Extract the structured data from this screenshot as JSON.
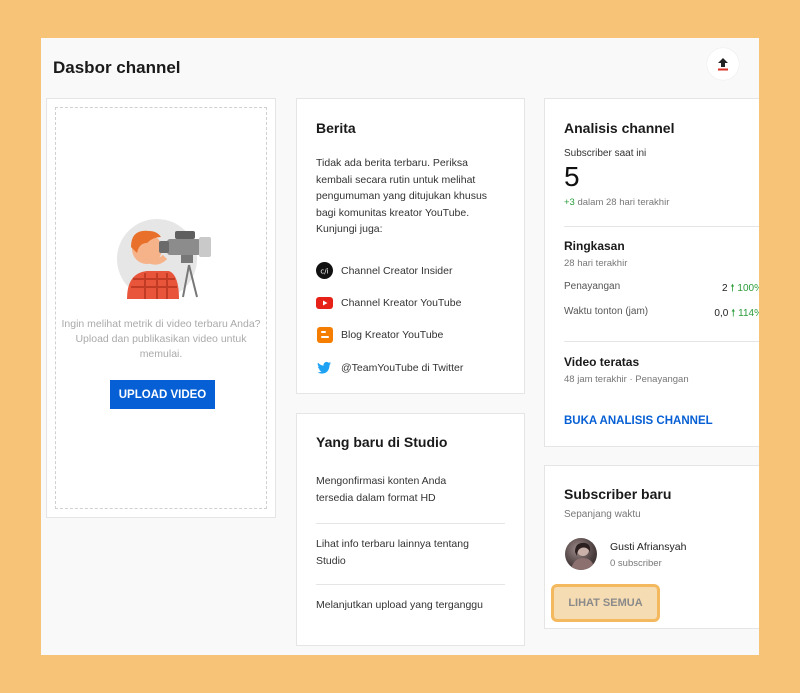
{
  "header": {
    "title": "Dasbor channel"
  },
  "upload_card": {
    "hint": "Ingin melihat metrik di video terbaru Anda? Upload dan publikasikan video untuk memulai.",
    "button": "UPLOAD VIDEO"
  },
  "news": {
    "title": "Berita",
    "body": "Tidak ada berita terbaru. Periksa kembali secara rutin untuk melihat pengumuman yang ditujukan khusus bagi komunitas kreator YouTube. Kunjungi juga:",
    "links": [
      {
        "label": "Channel Creator Insider",
        "icon": "creator-insider-icon"
      },
      {
        "label": "Channel Kreator YouTube",
        "icon": "youtube-icon"
      },
      {
        "label": "Blog Kreator YouTube",
        "icon": "blogger-icon"
      },
      {
        "label": "@TeamYouTube di Twitter",
        "icon": "twitter-icon"
      }
    ]
  },
  "whats_new": {
    "title": "Yang baru di Studio",
    "items": [
      "Mengonfirmasi konten Anda tersedia dalam format HD",
      "Lihat info terbaru lainnya tentang Studio",
      "Melanjutkan upload yang terganggu"
    ]
  },
  "analytics": {
    "title": "Analisis channel",
    "subs_label": "Subscriber saat ini",
    "subs_value": "5",
    "subs_change": "+3",
    "subs_period": "dalam 28 hari terakhir",
    "summary_title": "Ringkasan",
    "summary_period": "28 hari terakhir",
    "views_label": "Penayangan",
    "views_value": "2",
    "views_pct": "100%",
    "watch_label": "Waktu tonton (jam)",
    "watch_value": "0,0",
    "watch_pct": "114%",
    "top_title": "Video teratas",
    "top_sub": "48 jam terakhir · Penayangan",
    "link": "BUKA ANALISIS CHANNEL"
  },
  "new_subs": {
    "title": "Subscriber baru",
    "period": "Sepanjang waktu",
    "name": "Gusti Afriansyah",
    "count": "0 subscriber",
    "see_all": "LIHAT SEMUA"
  },
  "colors": {
    "accent_blue": "#065fd4",
    "positive_green": "#2a9c3a",
    "highlight": "#f4b95f"
  }
}
